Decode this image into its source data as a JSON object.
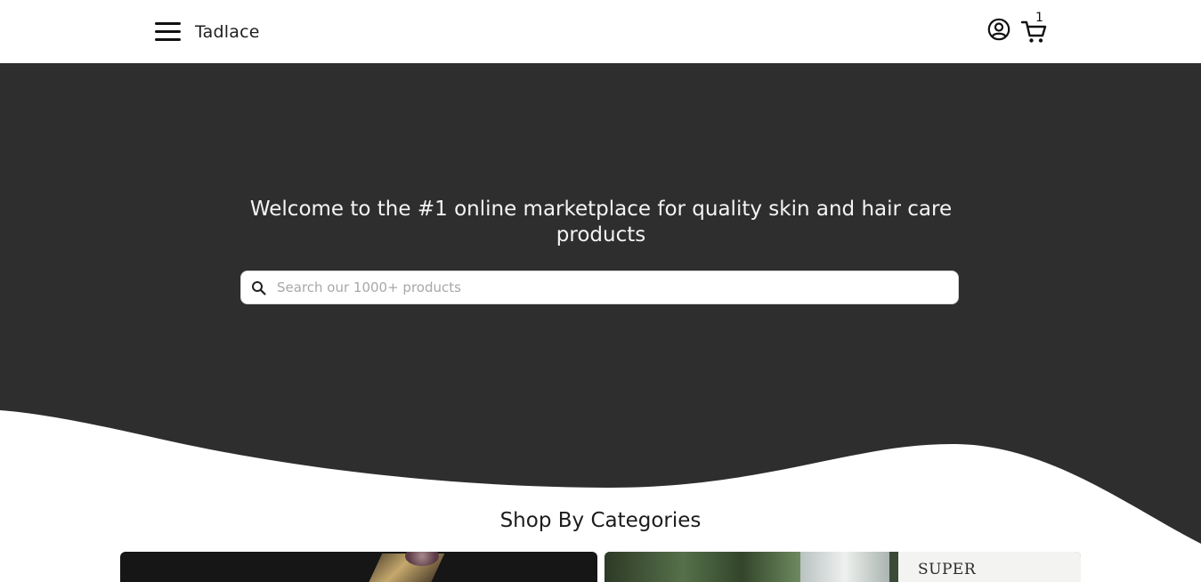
{
  "header": {
    "brand": "Tadlace",
    "cart_count": "1"
  },
  "hero": {
    "title": "Welcome to the #1 online marketplace for quality skin and hair care products",
    "search_placeholder": "Search our 1000+ products",
    "background_color": "#2e2e2e"
  },
  "categories": {
    "title": "Shop By Categories",
    "cards": [
      {
        "label": ""
      },
      {
        "label": "SUPER"
      }
    ]
  },
  "icons": {
    "menu": "hamburger-icon",
    "account": "user-circle-icon",
    "cart": "cart-icon",
    "search": "search-icon"
  }
}
